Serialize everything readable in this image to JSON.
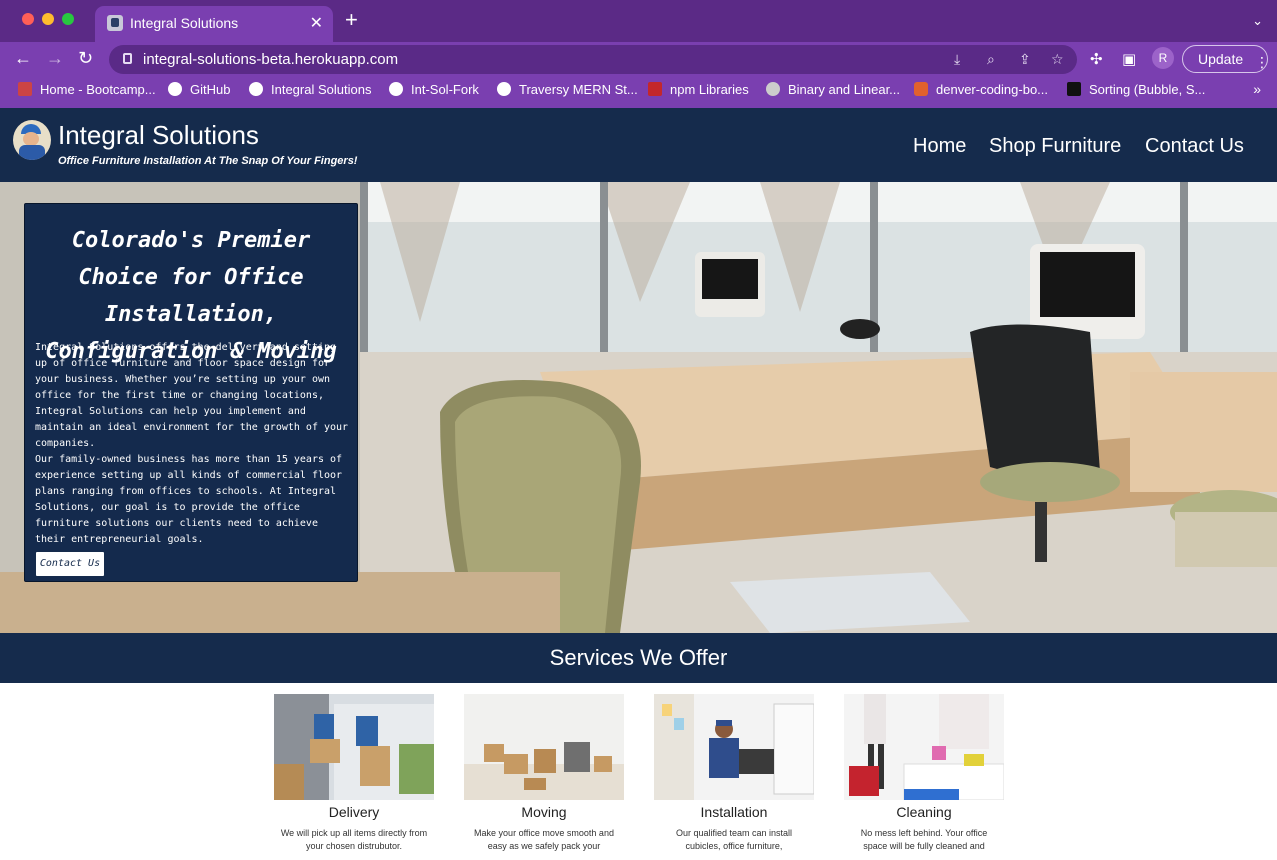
{
  "browser": {
    "tab_title": "Integral Solutions",
    "url": "integral-solutions-beta.herokuapp.com",
    "update_label": "Update",
    "profile_initial": "R",
    "bookmarks": [
      {
        "label": "Home - Bootcamp...",
        "icon": "bootcamp-icon"
      },
      {
        "label": "GitHub",
        "icon": "github-icon"
      },
      {
        "label": "Integral Solutions",
        "icon": "github-icon"
      },
      {
        "label": "Int-Sol-Fork",
        "icon": "github-icon"
      },
      {
        "label": "Traversy MERN St...",
        "icon": "github-icon"
      },
      {
        "label": "npm Libraries",
        "icon": "npm-icon"
      },
      {
        "label": "Binary and Linear...",
        "icon": "globe-icon"
      },
      {
        "label": "denver-coding-bo...",
        "icon": "gitlab-icon"
      },
      {
        "label": "Sorting (Bubble, S...",
        "icon": "visualgo-icon"
      }
    ]
  },
  "site": {
    "brand_title": "Integral Solutions",
    "tagline": "Office Furniture Installation At The Snap Of Your Fingers!",
    "nav": [
      "Home",
      "Shop Furniture",
      "Contact Us"
    ],
    "colors": {
      "navy": "#152b4c",
      "browser_purple": "#7a3fb0"
    }
  },
  "hero": {
    "title": "Colorado's Premier Choice for Office Installation, Configuration & Moving",
    "paragraph1": "Integral Solutions offers the delivery and setting up of office furniture and floor space design for your business. Whether you’re setting up your own office for the first time or changing locations, Integral Solutions can help you implement and maintain an ideal environment for the growth of your companies.",
    "paragraph2": "Our family-owned business has more than 15 years of experience setting up all kinds of commercial floor plans ranging from offices to schools. At Integral Solutions, our goal is to provide the office furniture solutions our clients need to achieve their entrepreneurial goals.",
    "cta_label": "Contact Us"
  },
  "services": {
    "title": "Services We Offer",
    "items": [
      {
        "name": "Delivery",
        "desc": "We will pick up all items directly from your chosen distrubutor."
      },
      {
        "name": "Moving",
        "desc": "Make your office move smooth and easy as we safely pack your"
      },
      {
        "name": "Installation",
        "desc": "Our qualified team can install cubicles, office furniture,"
      },
      {
        "name": "Cleaning",
        "desc": "No mess left behind. Your office space will be fully cleaned and"
      }
    ]
  }
}
